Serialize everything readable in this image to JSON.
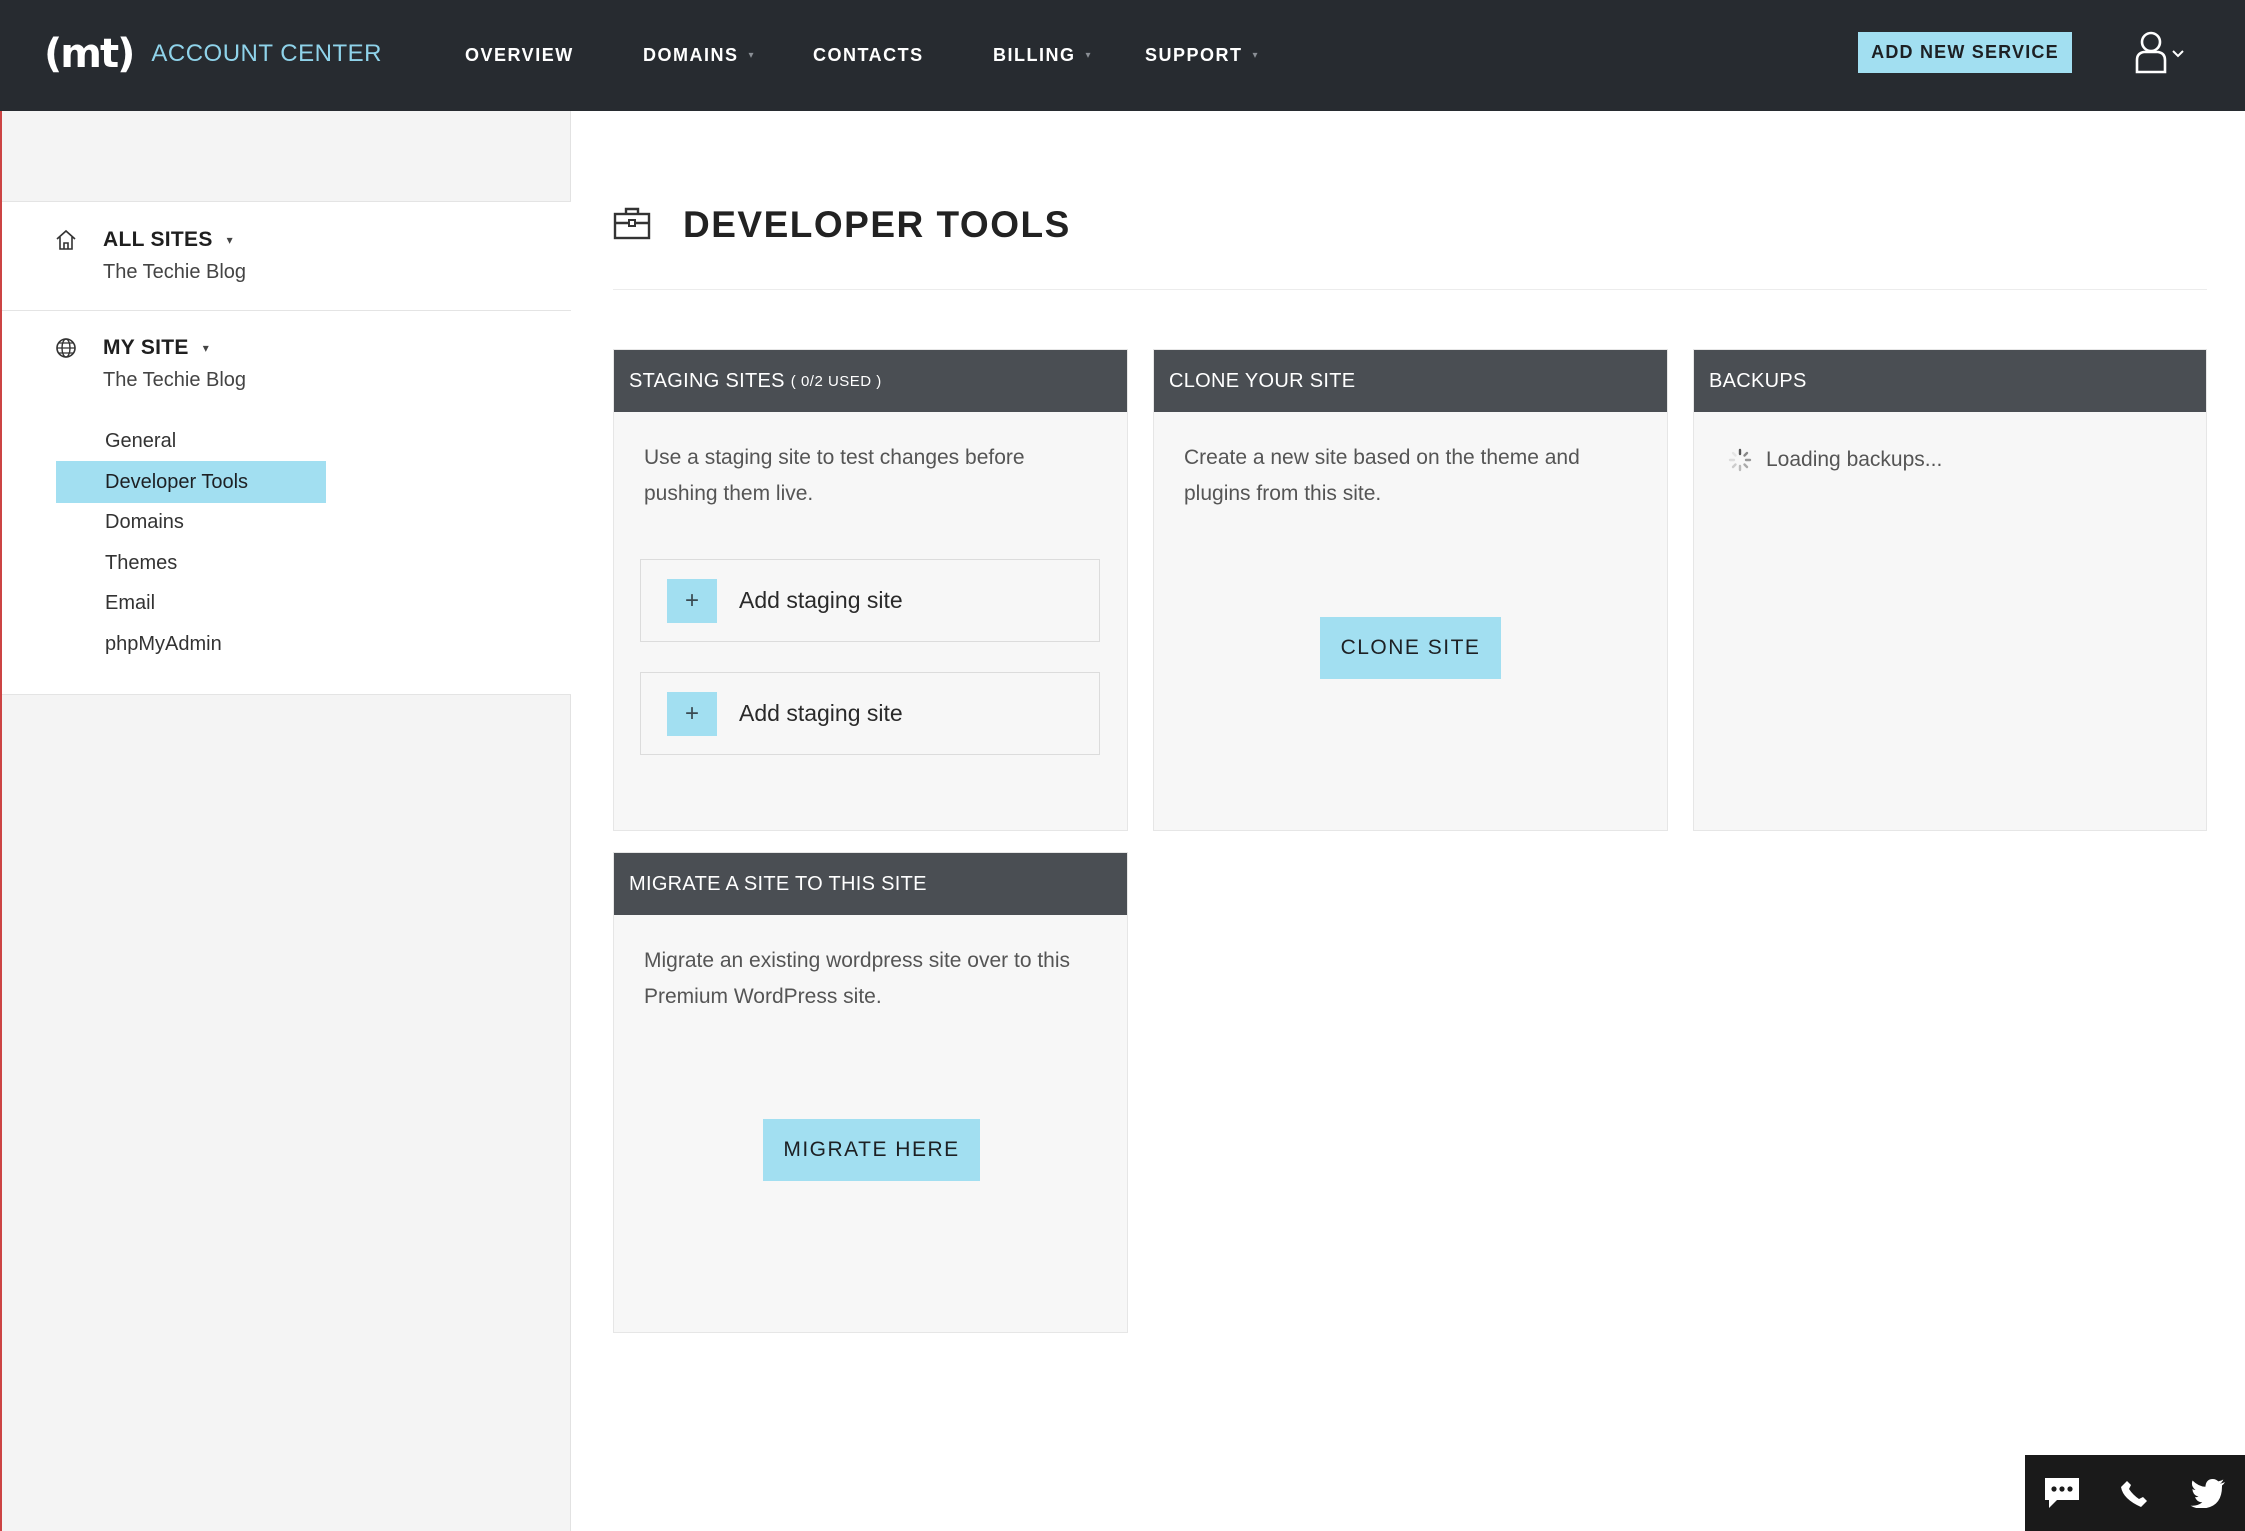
{
  "brand": {
    "logo": "(mt)",
    "name": "ACCOUNT CENTER"
  },
  "nav": {
    "overview": "OVERVIEW",
    "domains": "DOMAINS",
    "contacts": "CONTACTS",
    "billing": "BILLING",
    "support": "SUPPORT",
    "caret": "▾"
  },
  "header": {
    "add_service": "ADD NEW SERVICE"
  },
  "sidebar": {
    "all_sites": {
      "title": "ALL SITES",
      "subtitle": "The Techie Blog"
    },
    "my_site": {
      "title": "MY SITE",
      "subtitle": "The Techie Blog"
    },
    "caret": "▾",
    "items": [
      {
        "label": "General",
        "active": false
      },
      {
        "label": "Developer Tools",
        "active": true
      },
      {
        "label": "Domains",
        "active": false
      },
      {
        "label": "Themes",
        "active": false
      },
      {
        "label": "Email",
        "active": false
      },
      {
        "label": "phpMyAdmin",
        "active": false
      }
    ]
  },
  "page": {
    "title": "DEVELOPER TOOLS"
  },
  "cards": {
    "staging": {
      "title": "STAGING SITES",
      "usage": "( 0/2 USED )",
      "text": "Use a staging site to test changes before pushing them live.",
      "add_label": "Add staging site",
      "plus": "+"
    },
    "clone": {
      "title": "CLONE YOUR SITE",
      "text": "Create a new site based on the theme and plugins from this site.",
      "button": "CLONE SITE"
    },
    "backups": {
      "title": "BACKUPS",
      "loading": "Loading backups..."
    },
    "migrate": {
      "title": "MIGRATE A SITE TO THIS SITE",
      "text": "Migrate an existing wordpress site over to this Premium WordPress site.",
      "button": "MIGRATE HERE"
    }
  },
  "colors": {
    "topbar": "#272b30",
    "accent": "#a2dff1",
    "card_header": "#4a4e53",
    "brand_text": "#8fd3ea"
  },
  "icons": [
    "home-icon",
    "globe-icon",
    "briefcase-icon",
    "user-icon",
    "chat-icon",
    "phone-icon",
    "twitter-icon",
    "spinner-icon"
  ]
}
